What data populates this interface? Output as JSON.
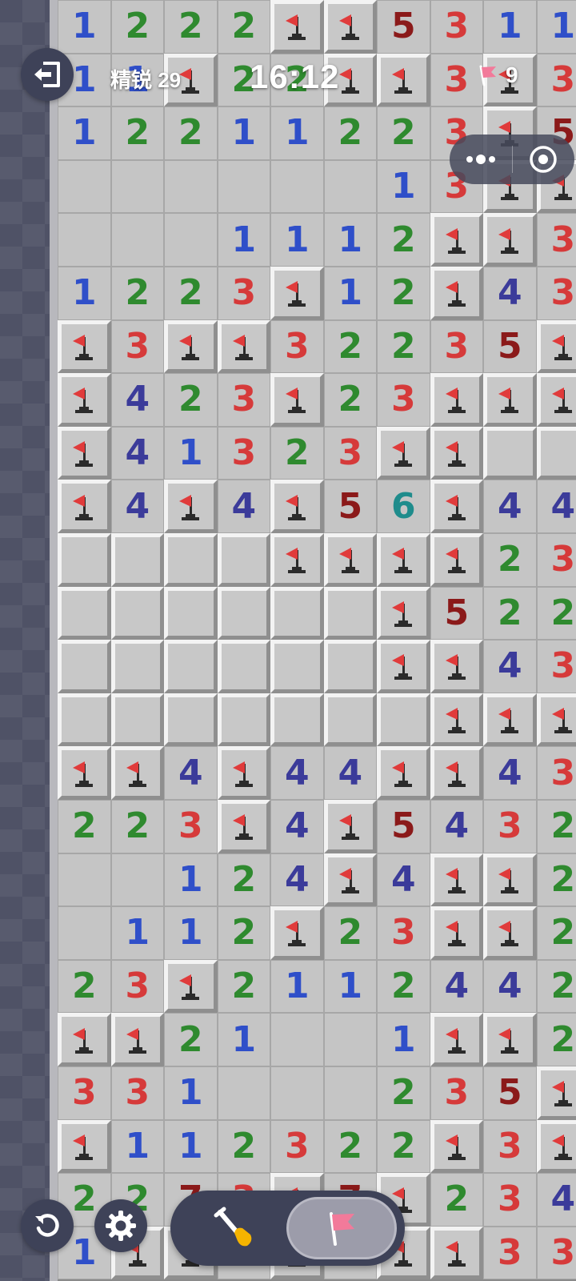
{
  "hud": {
    "difficulty": "精锐 29",
    "timer": "16:12",
    "flags_remaining": "9"
  },
  "colors": {
    "1": "#2f4fc9",
    "2": "#2f8a2f",
    "3": "#d63a3a",
    "4": "#3b3b9a",
    "5": "#8b1a1a",
    "6": "#1f8c8c",
    "7": "#8b1a1a",
    "flag": "#e03b3b",
    "pink_flag": "#f27a9a"
  },
  "board": {
    "cols": 10,
    "rows": 24,
    "grid": [
      "1222FF5311",
      "11F22FF3F3",
      "12211223F5",
      "......13FF",
      "...1112FF3",
      "1223F12F43",
      "F3FF32235F",
      "F423F23FFF",
      "F41323FF##",
      "F4F4F56F44",
      "####FFFF23",
      "######F522",
      "######FF43",
      "#######FFF",
      "FF4F44FF43",
      "223F4F5432",
      "..124F4FF2",
      ".112F23FF2",
      "23F2112442",
      "FF21..1FF2",
      "331...235F",
      "F112322F3F",
      "2273F7F234",
      "1FF3F7FF33"
    ]
  }
}
